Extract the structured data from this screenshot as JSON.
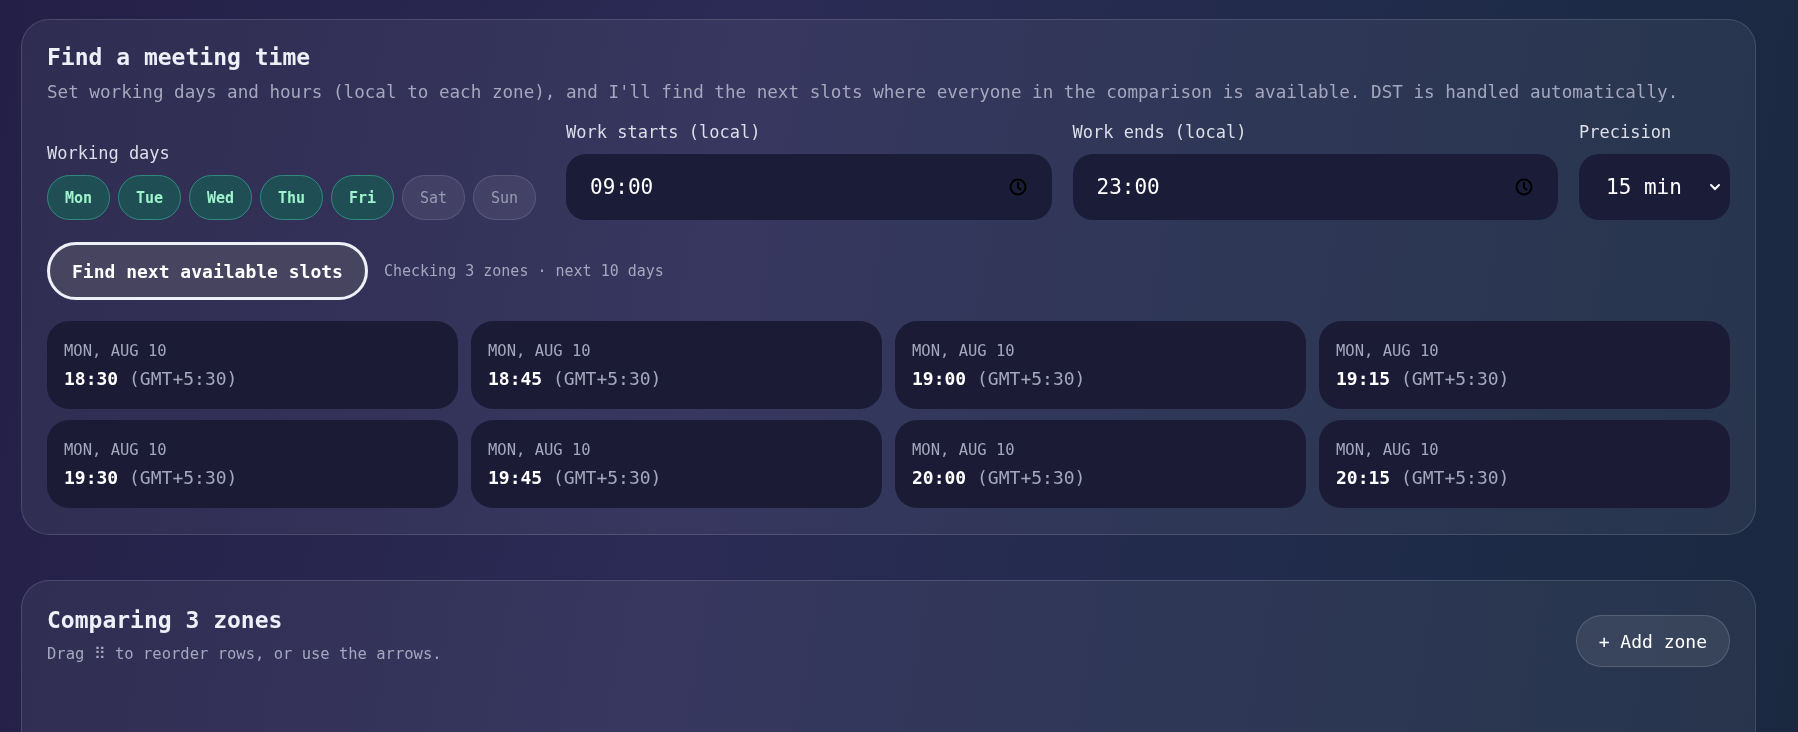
{
  "meeting": {
    "title": "Find a meeting time",
    "description": "Set working days and hours (local to each zone), and I'll find the next slots where everyone in the comparison is available. DST is handled automatically.",
    "working_days": {
      "label": "Working days",
      "days": [
        {
          "label": "Mon",
          "selected": true
        },
        {
          "label": "Tue",
          "selected": true
        },
        {
          "label": "Wed",
          "selected": true
        },
        {
          "label": "Thu",
          "selected": true
        },
        {
          "label": "Fri",
          "selected": true
        },
        {
          "label": "Sat",
          "selected": false
        },
        {
          "label": "Sun",
          "selected": false
        }
      ]
    },
    "work_starts": {
      "label": "Work starts (local)",
      "value": "09:00"
    },
    "work_ends": {
      "label": "Work ends (local)",
      "value": "23:00"
    },
    "precision": {
      "label": "Precision",
      "value": "15 min"
    },
    "find_button": "Find next available slots",
    "status": "Checking 3 zones · next 10 days",
    "slots": [
      {
        "date": "MON, AUG 10",
        "time": "18:30",
        "zone": "(GMT+5:30)"
      },
      {
        "date": "MON, AUG 10",
        "time": "18:45",
        "zone": "(GMT+5:30)"
      },
      {
        "date": "MON, AUG 10",
        "time": "19:00",
        "zone": "(GMT+5:30)"
      },
      {
        "date": "MON, AUG 10",
        "time": "19:15",
        "zone": "(GMT+5:30)"
      },
      {
        "date": "MON, AUG 10",
        "time": "19:30",
        "zone": "(GMT+5:30)"
      },
      {
        "date": "MON, AUG 10",
        "time": "19:45",
        "zone": "(GMT+5:30)"
      },
      {
        "date": "MON, AUG 10",
        "time": "20:00",
        "zone": "(GMT+5:30)"
      },
      {
        "date": "MON, AUG 10",
        "time": "20:15",
        "zone": "(GMT+5:30)"
      }
    ]
  },
  "zones": {
    "title": "Comparing 3 zones",
    "hint": "Drag ⠿ to reorder rows, or use the arrows.",
    "add_button": "+ Add zone"
  }
}
